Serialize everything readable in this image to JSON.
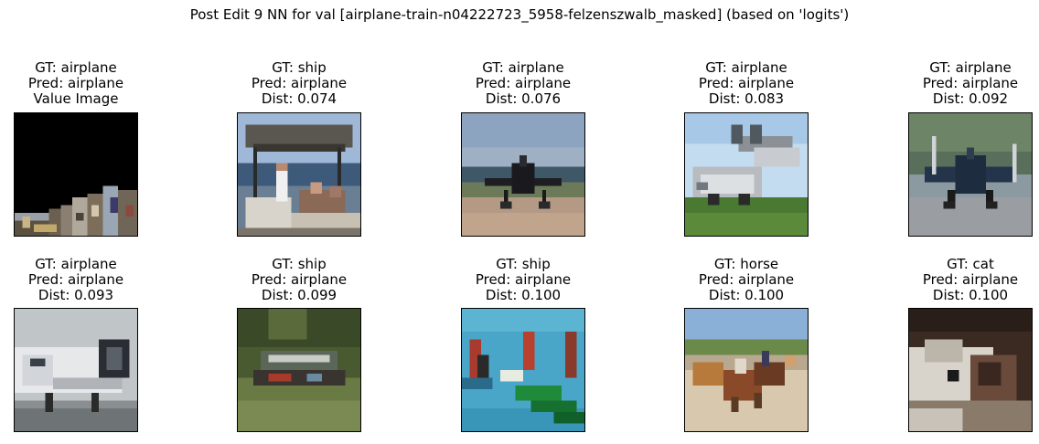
{
  "figure": {
    "title": "Post Edit 9 NN for val [airplane-train-n04222723_5958-felzenszwalb_masked] (based on 'logits')"
  },
  "panels": [
    {
      "lines": [
        "GT: airplane",
        "Pred: airplane",
        "Value Image"
      ],
      "scene": "masked-query"
    },
    {
      "lines": [
        "GT: ship",
        "Pred: airplane",
        "Dist: 0.074"
      ],
      "scene": "boat-canopy"
    },
    {
      "lines": [
        "GT: airplane",
        "Pred: airplane",
        "Dist: 0.076"
      ],
      "scene": "plane-runway"
    },
    {
      "lines": [
        "GT: airplane",
        "Pred: airplane",
        "Dist: 0.083"
      ],
      "scene": "seaplane-grass"
    },
    {
      "lines": [
        "GT: airplane",
        "Pred: airplane",
        "Dist: 0.092"
      ],
      "scene": "fighter-tarmac"
    },
    {
      "lines": [
        "GT: airplane",
        "Pred: airplane",
        "Dist: 0.093"
      ],
      "scene": "jet-closeup"
    },
    {
      "lines": [
        "GT: ship",
        "Pred: airplane",
        "Dist: 0.099"
      ],
      "scene": "boat-river"
    },
    {
      "lines": [
        "GT: ship",
        "Pred: airplane",
        "Dist: 0.100"
      ],
      "scene": "boats-water"
    },
    {
      "lines": [
        "GT: horse",
        "Pred: airplane",
        "Dist: 0.100"
      ],
      "scene": "horses-race"
    },
    {
      "lines": [
        "GT: cat",
        "Pred: airplane",
        "Dist: 0.100"
      ],
      "scene": "cat-closeup"
    }
  ]
}
